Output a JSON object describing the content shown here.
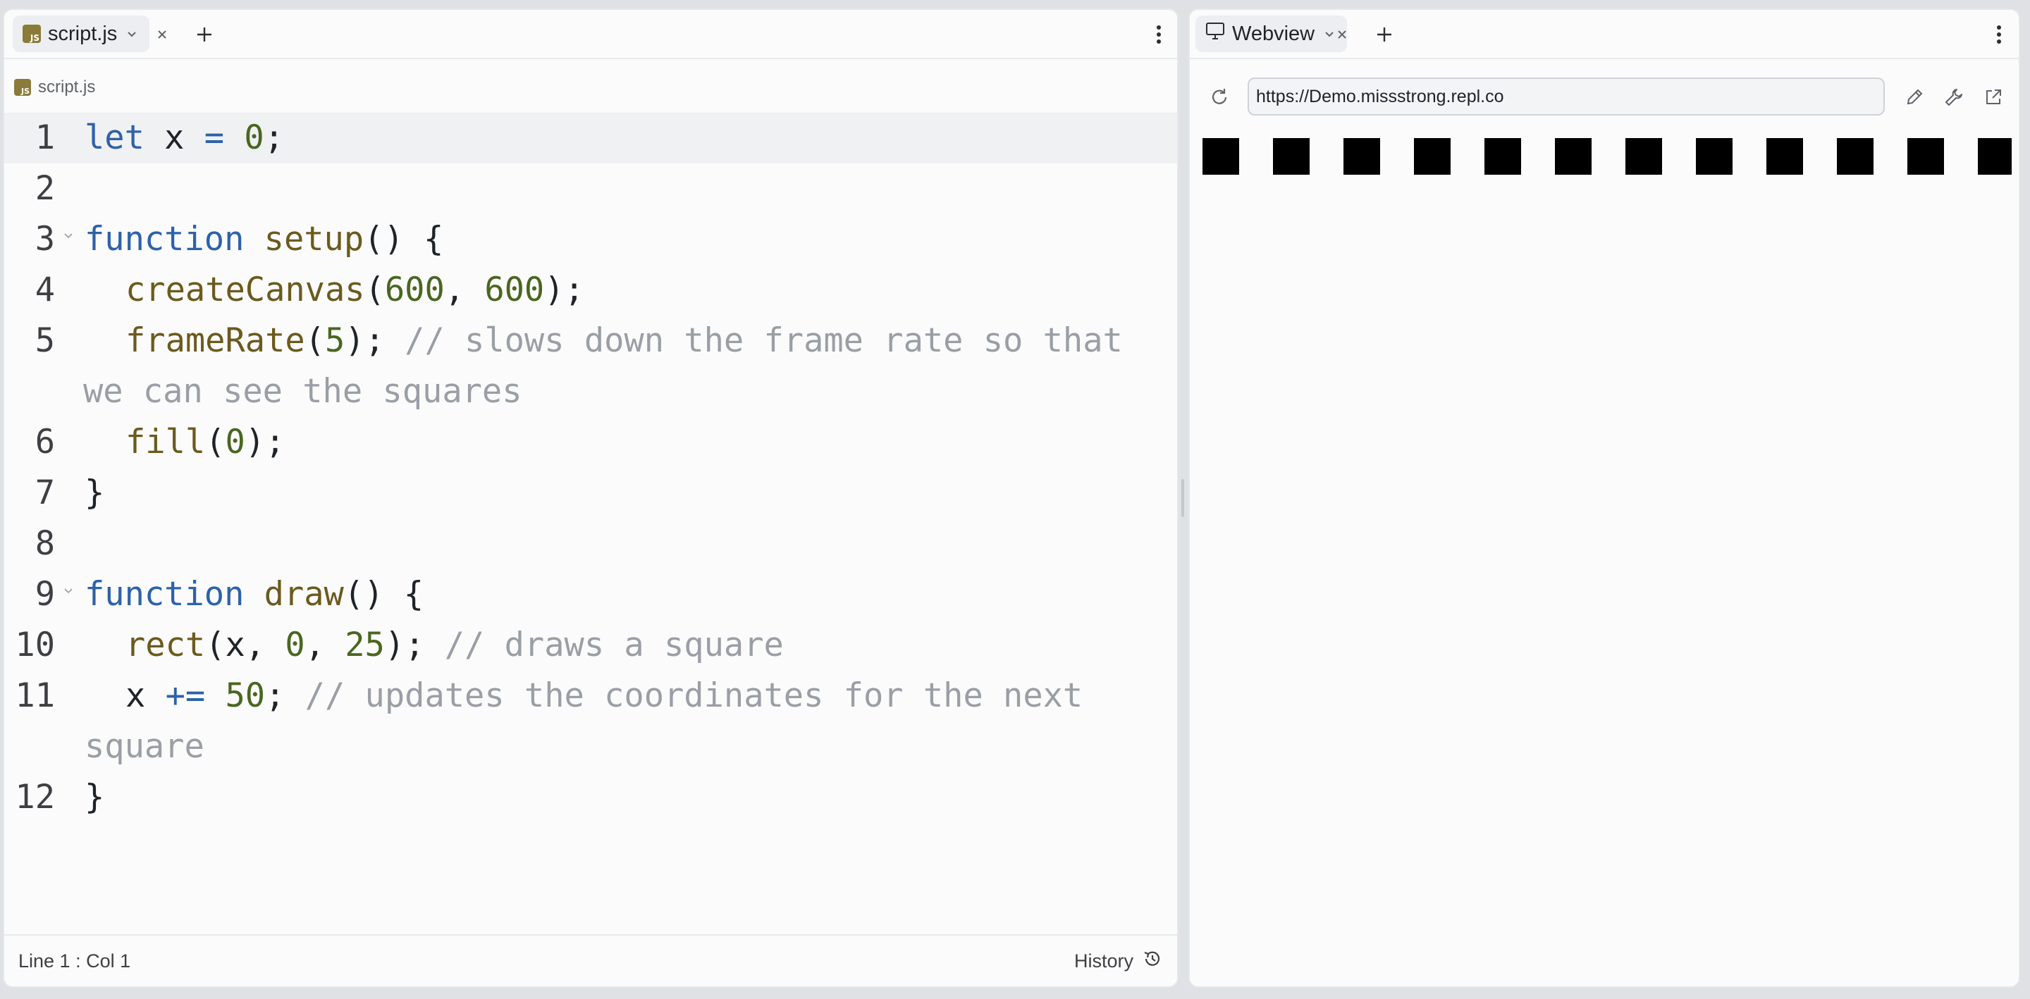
{
  "editor": {
    "tab_label": "script.js",
    "breadcrumb": "script.js",
    "status": "Line 1 : Col 1",
    "history_label": "History",
    "lines": [
      {
        "n": "1"
      },
      {
        "n": "2"
      },
      {
        "n": "3"
      },
      {
        "n": "4"
      },
      {
        "n": "5"
      },
      {
        "n": "6"
      },
      {
        "n": "7"
      },
      {
        "n": "8"
      },
      {
        "n": "9"
      },
      {
        "n": "10"
      },
      {
        "n": "11"
      },
      {
        "n": "12"
      }
    ],
    "tokens": {
      "l1": [
        "let",
        " x ",
        "=",
        " ",
        "0",
        ";"
      ],
      "l3": [
        "function",
        " ",
        "setup",
        "() {"
      ],
      "l4": [
        "createCanvas",
        "(",
        "600",
        ", ",
        "600",
        ");"
      ],
      "l5": [
        "frameRate",
        "(",
        "5",
        "); ",
        "// slows down the frame rate so that",
        "we can see the squares"
      ],
      "l6": [
        "fill",
        "(",
        "0",
        ");"
      ],
      "l7": [
        "}"
      ],
      "l9": [
        "function",
        " ",
        "draw",
        "() {"
      ],
      "l10": [
        "rect",
        "(x, ",
        "0",
        ", ",
        "25",
        "); ",
        "// draws a square"
      ],
      "l11": [
        "x ",
        "+=",
        " ",
        "50",
        "; ",
        "// updates the coordinates for the next",
        "square"
      ],
      "l12": [
        "}"
      ]
    }
  },
  "webview": {
    "tab_label": "Webview",
    "url": "https://Demo.missstrong.repl.co",
    "squares_visible": 12
  },
  "colors": {
    "keyword": "#2d62a8",
    "function": "#6b5a1d",
    "number": "#4a6621",
    "comment": "#9a9ea5",
    "js_badge": "#8b7b3a"
  },
  "icons": {
    "editor_tab": "js-file-icon",
    "webview_tab": "monitor-icon",
    "add_tab": "plus-icon",
    "menu": "kebab-menu-icon",
    "reload": "reload-icon",
    "edit": "pencil-icon",
    "devtools": "wrench-icon",
    "open_external": "external-link-icon",
    "history": "history-icon"
  }
}
